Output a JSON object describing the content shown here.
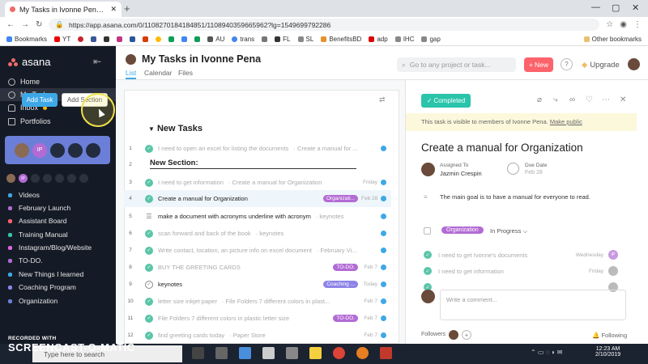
{
  "browser": {
    "tab_title": "My Tasks in Ivonne Pena - Crea",
    "url": "https://app.asana.com/0/1108270184184851/1108940359665962?lg=1549699792286",
    "bookmarks": [
      "Bookmarks",
      "YT",
      "",
      "",
      "",
      "",
      "",
      "",
      "",
      "",
      "",
      "",
      "AU",
      "trans",
      "",
      "FL",
      "SL",
      "BenefitsBD",
      "adp",
      "IHC",
      "gap"
    ],
    "other_bookmarks": "Other bookmarks"
  },
  "sidebar": {
    "logo": "asana",
    "nav": [
      {
        "label": "Home",
        "icon": "home-icon"
      },
      {
        "label": "My Tasks",
        "icon": "check-circle-icon"
      },
      {
        "label": "Inbox",
        "icon": "bell-icon"
      },
      {
        "label": "Portfolios",
        "icon": "chart-icon"
      }
    ],
    "team_avatar_initials": "IP",
    "projects": [
      {
        "label": "Videos",
        "color": "#3ea8e7"
      },
      {
        "label": "February Launch",
        "color": "#b36bd4"
      },
      {
        "label": "Assistant Board",
        "color": "#fc636b"
      },
      {
        "label": "Training Manual",
        "color": "#37c5ab"
      },
      {
        "label": "Instagram/Blog/Website",
        "color": "#e362e3"
      },
      {
        "label": "TO-DO.",
        "color": "#b36bd4"
      },
      {
        "label": "New Things I learned",
        "color": "#3ea8e7"
      },
      {
        "label": "Coaching Program",
        "color": "#8d84e8"
      },
      {
        "label": "Organization",
        "color": "#6b7fd8"
      }
    ],
    "recorded": "RECORDED WITH"
  },
  "header": {
    "title": "My Tasks in Ivonne Pena",
    "more": "···",
    "tabs": [
      "List",
      "Calendar",
      "Files"
    ],
    "search_placeholder": "Go to any project or task...",
    "new_label": "New",
    "help": "?",
    "upgrade": "Upgrade"
  },
  "list": {
    "add_task": "Add Task",
    "add_section": "Add Section",
    "section1": "New Tasks",
    "section2": "New Section:",
    "rows": [
      {
        "n": "1",
        "name": "I need to open an excel for listing the documents",
        "proj": "· Create a manual for ...",
        "tag": "",
        "tagcolor": "",
        "date": "",
        "state": "done",
        "dark": false
      },
      {
        "n": "2",
        "name": "",
        "proj": "",
        "tag": "",
        "tagcolor": "",
        "date": "",
        "state": "none",
        "dark": false
      },
      {
        "n": "3",
        "name": "I need to get information",
        "proj": "· Create a manual for Organization",
        "tag": "",
        "tagcolor": "",
        "date": "Friday",
        "state": "done",
        "dark": false
      },
      {
        "n": "4",
        "name": "Create a manual for Organization",
        "proj": "",
        "tag": "Organizati...",
        "tagcolor": "#b36bd4",
        "date": "Feb 28",
        "state": "done",
        "dark": true
      },
      {
        "n": "5",
        "name": "make a document with acronyms underline with acronym",
        "proj": "· keynotes",
        "tag": "",
        "tagcolor": "",
        "date": "",
        "state": "list",
        "dark": true
      },
      {
        "n": "6",
        "name": "scan forward and back of the book",
        "proj": "· keynotes",
        "tag": "",
        "tagcolor": "",
        "date": "",
        "state": "done",
        "dark": false
      },
      {
        "n": "7",
        "name": "Write contact, location, an picture info on excel document",
        "proj": "· February Vi...",
        "tag": "",
        "tagcolor": "",
        "date": "",
        "state": "done",
        "dark": false
      },
      {
        "n": "8",
        "name": "BUY THE GREETING CARDS",
        "proj": "",
        "tag": "TO-DO.",
        "tagcolor": "#b36bd4",
        "date": "Feb 7",
        "state": "done",
        "dark": false
      },
      {
        "n": "9",
        "name": "keynotes",
        "proj": "",
        "tag": "Coaching ...",
        "tagcolor": "#8d84e8",
        "date": "Today",
        "state": "open",
        "dark": true
      },
      {
        "n": "10",
        "name": "letter size inkjet paper",
        "proj": "· File Folders 7 different colors in plast...",
        "tag": "",
        "tagcolor": "",
        "date": "Feb 7",
        "state": "done",
        "dark": false
      },
      {
        "n": "11",
        "name": "File Folders 7 different colors in plastic letter size",
        "proj": "",
        "tag": "TO-DO.",
        "tagcolor": "#b36bd4",
        "date": "Feb 7",
        "state": "done",
        "dark": false
      },
      {
        "n": "12",
        "name": "find greeting cards today",
        "proj": "· Paper Store",
        "tag": "",
        "tagcolor": "",
        "date": "Feb 7",
        "state": "done",
        "dark": false
      }
    ]
  },
  "detail": {
    "completed": "Completed",
    "visibility": "This task is visible to members of Ivonne Pena.",
    "make_public": "Make public",
    "title": "Create a manual for Organization",
    "assigned_label": "Assigned To",
    "assignee": "Jazmin Crespin",
    "due_label": "Due Date",
    "due_value": "Feb 28",
    "description": "The main goal is to have a manual for everyone to read.",
    "tag": "Organization",
    "status": "In Progress",
    "subtasks": [
      {
        "name": "I need to get Ivonne's documents",
        "date": "Wednesday",
        "av": "IP"
      },
      {
        "name": "I need to get information",
        "date": "Friday",
        "av": ""
      },
      {
        "name": "",
        "date": "",
        "av": ""
      }
    ],
    "comment_placeholder": "Write a comment...",
    "followers": "Followers",
    "following": "Following"
  },
  "taskbar": {
    "search_placeholder": "Type here to search",
    "watermark": "SCREENCAST-O-MATIC",
    "time": "12:23 AM",
    "date": "2/10/2019"
  }
}
